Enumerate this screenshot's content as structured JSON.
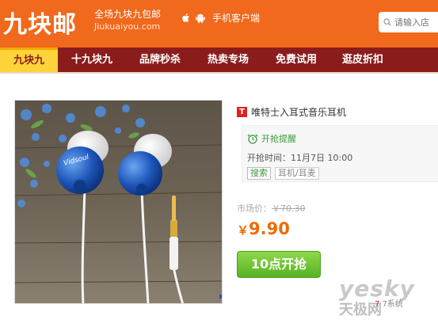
{
  "header": {
    "logo": "九块邮",
    "slogan": "全场九块九包邮",
    "domain": "Jiukuaiyou.com",
    "app_label": "手机客户端",
    "search_placeholder": "请输入店",
    "bg_color": "#f0691c"
  },
  "nav": {
    "items": [
      {
        "label": "九块九",
        "active": true
      },
      {
        "label": "十九块九"
      },
      {
        "label": "品牌秒杀"
      },
      {
        "label": "热卖专场"
      },
      {
        "label": "免费试用"
      },
      {
        "label": "逛皮折扣"
      }
    ],
    "bg_color": "#8b1c1c",
    "active_color": "#ffd33a"
  },
  "product": {
    "badge": "T",
    "title": "唯特士入耳式音乐耳机",
    "remind_label": "开抢提醒",
    "start_time": "开抢时间：11月7日 10:00",
    "tags": [
      "搜索",
      "耳机/耳麦"
    ],
    "market_price_label": "市场价：",
    "market_price": "￥70.30",
    "currency": "￥",
    "price": "9.90",
    "buy_button": "10点开抢",
    "color_swatches": [
      "#1d55b8",
      "#b22020",
      "#d8d8d8",
      "#111111"
    ]
  },
  "watermark": {
    "line1": "yesky",
    "line2": "天极网"
  },
  "footer_fragment": {
    "red": "7",
    "text": "7系统"
  }
}
